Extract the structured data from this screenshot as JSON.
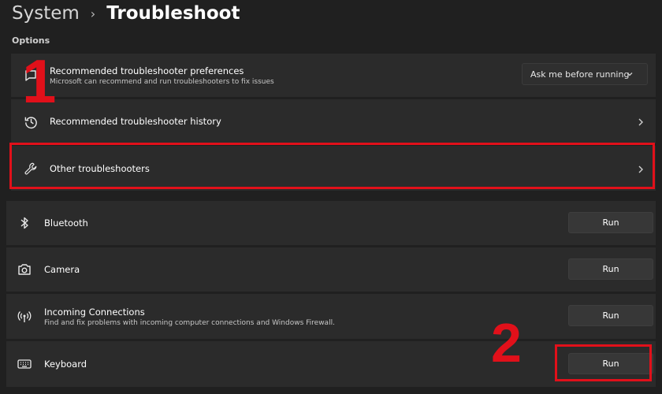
{
  "breadcrumb": {
    "parent": "System",
    "separator": "›",
    "current": "Troubleshoot"
  },
  "section_label": "Options",
  "options": {
    "preferences": {
      "title": "Recommended troubleshooter preferences",
      "subtitle": "Microsoft can recommend and run troubleshooters to fix issues",
      "dropdown_value": "Ask me before running",
      "icon": "chat-bubble-icon"
    },
    "history": {
      "title": "Recommended troubleshooter history",
      "icon": "history-icon"
    },
    "other": {
      "title": "Other troubleshooters",
      "icon": "wrench-icon"
    }
  },
  "troubleshooters": [
    {
      "title": "Bluetooth",
      "button": "Run",
      "icon": "bluetooth-icon"
    },
    {
      "title": "Camera",
      "button": "Run",
      "icon": "camera-icon"
    },
    {
      "title": "Incoming Connections",
      "subtitle": "Find and fix problems with incoming computer connections and Windows Firewall.",
      "button": "Run",
      "icon": "wifi-antenna-icon"
    },
    {
      "title": "Keyboard",
      "button": "Run",
      "icon": "keyboard-icon"
    }
  ],
  "annotations": {
    "step1": "1",
    "step2": "2",
    "color": "#e1101a"
  }
}
